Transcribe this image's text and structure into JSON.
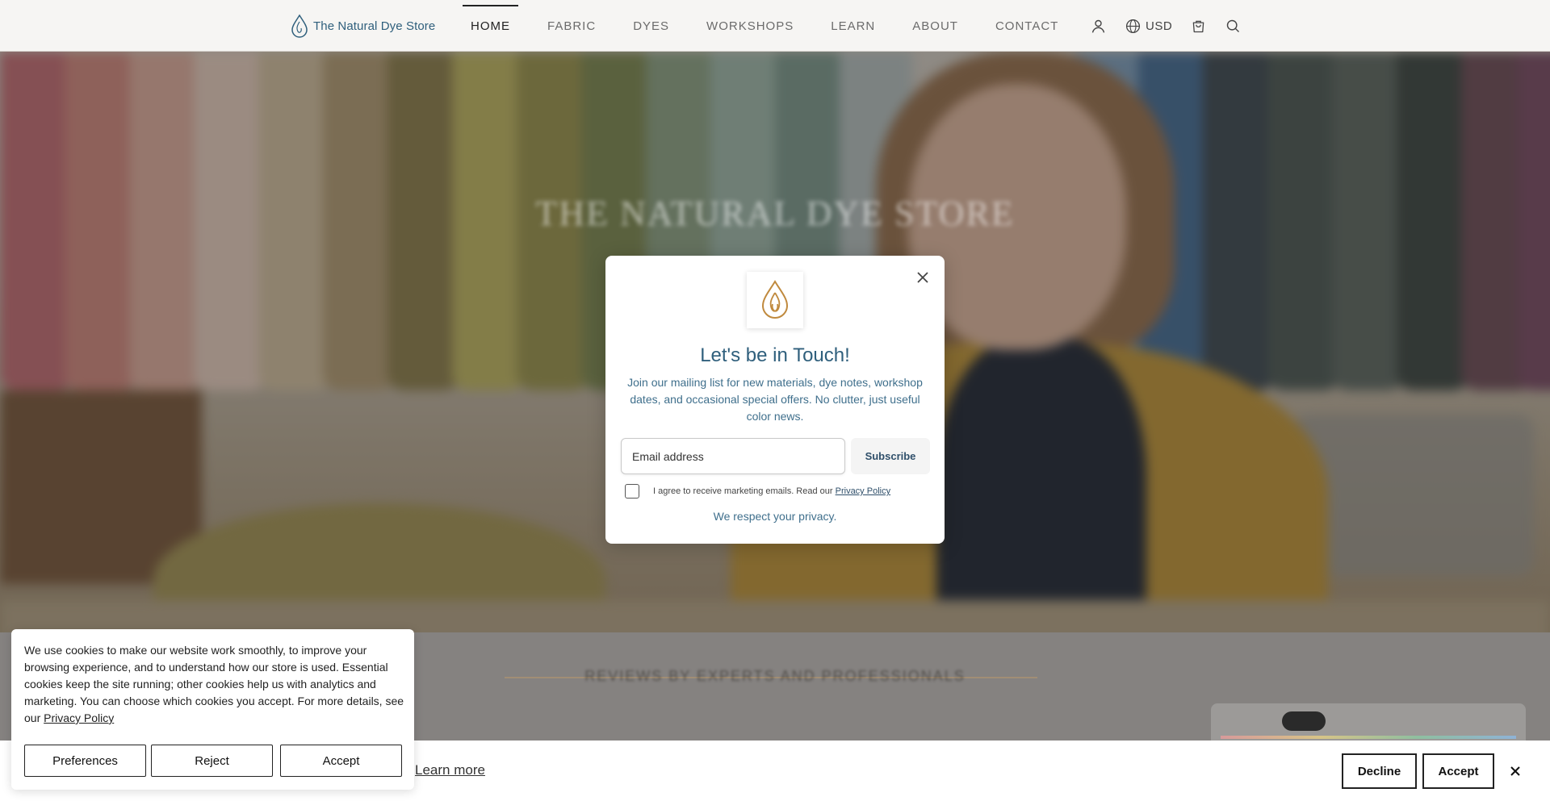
{
  "header": {
    "brand": "The Natural Dye Store",
    "nav": [
      {
        "label": "HOME",
        "active": true
      },
      {
        "label": "FABRIC"
      },
      {
        "label": "DYES"
      },
      {
        "label": "WORKSHOPS"
      },
      {
        "label": "LEARN"
      },
      {
        "label": "ABOUT"
      },
      {
        "label": "CONTACT"
      }
    ],
    "tools": {
      "account_icon": "user-icon",
      "currency_icon": "globe-icon",
      "currency": "USD",
      "cart_icon": "shopping-bag-icon",
      "search_icon": "search-icon"
    }
  },
  "hero": {
    "title": "THE NATURAL DYE STORE"
  },
  "reviews": {
    "title": "REVIEWS BY EXPERTS AND PROFESSIONALS"
  },
  "popup": {
    "title": "Let's be in Touch!",
    "description": "Join our mailing list for new materials, dye notes, workshop dates, and occasional special offers. No clutter, just useful color news.",
    "email_placeholder": "Email address",
    "subscribe_label": "Subscribe",
    "consent_text": "I agree to receive marketing emails. Read our",
    "consent_link": "Privacy Policy",
    "privacy_note": "We respect your privacy.",
    "consent_checked": false
  },
  "cookie_panel": {
    "text": "We use cookies to make our website work smoothly, to improve your browsing experience, and to understand how our store is used. Essential cookies keep the site running; other cookies help us with analytics and marketing. You can choose which cookies you accept. For more details, see our",
    "link": "Privacy Policy",
    "preferences_label": "Preferences",
    "reject_label": "Reject",
    "accept_label": "Accept"
  },
  "bottom_bar": {
    "learn_more": "Learn more",
    "decline_label": "Decline",
    "accept_label": "Accept"
  },
  "colors": {
    "brand_blue": "#2f5f7c",
    "logo_gold": "#c08a3e"
  }
}
